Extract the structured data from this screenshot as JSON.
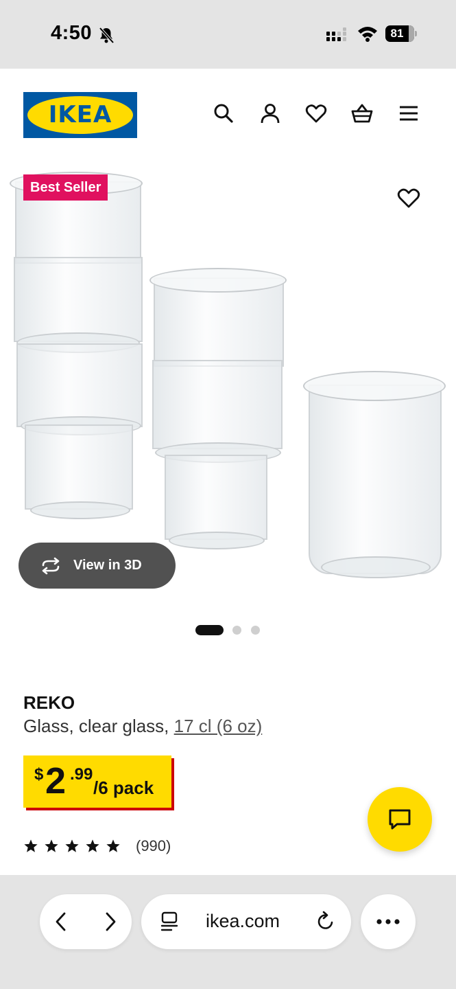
{
  "status_bar": {
    "time": "4:50",
    "battery_level": "81",
    "icons": [
      "bell-slash-icon",
      "cellular-signal-icon",
      "wifi-icon",
      "battery-icon"
    ]
  },
  "header": {
    "logo_text": "IKEA",
    "icons": [
      "search-icon",
      "account-icon",
      "heart-icon",
      "basket-icon",
      "menu-icon"
    ],
    "colors": {
      "brand_blue": "#0058a3",
      "brand_yellow": "#ffdb00"
    }
  },
  "gallery": {
    "badge": "Best Seller",
    "badge_color": "#e0115f",
    "view_3d_label": "View in 3D",
    "slide_count": 3,
    "active_slide": 1
  },
  "product": {
    "name": "REKO",
    "description": "Glass, clear glass, ",
    "size": "17 cl (6 oz)",
    "price": {
      "currency": "$",
      "integer": "2",
      "decimal": ".99",
      "unit": "/6 pack"
    },
    "rating": {
      "stars": 5,
      "review_count": "(990)"
    }
  },
  "chat": {
    "icon": "chat-icon"
  },
  "browser": {
    "url": "ikea.com",
    "icons": [
      "back-icon",
      "forward-icon",
      "reader-icon",
      "reload-icon",
      "more-icon"
    ]
  }
}
